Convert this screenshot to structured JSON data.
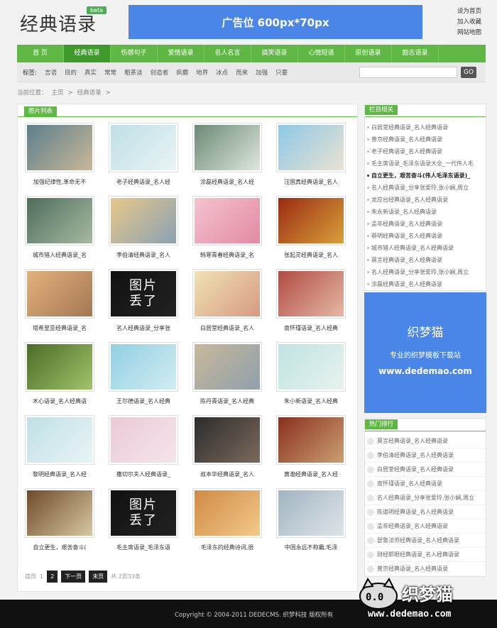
{
  "header": {
    "logo": "经典语录",
    "beta": "beta",
    "ad": "广告位 600px*70px",
    "links": [
      "设为首页",
      "加入收藏",
      "网站地图"
    ]
  },
  "nav": [
    "首 页",
    "经典语录",
    "伤感句子",
    "爱情语录",
    "名人名言",
    "搞笑语录",
    "心情短语",
    "原创语录",
    "励志语录"
  ],
  "tags": {
    "label": "标签:",
    "items": [
      "言语",
      "目的",
      "真实",
      "常常",
      "粗茶淡",
      "创造者",
      "疯癫",
      "地界",
      "冰点",
      "而来",
      "加强",
      "只要"
    ]
  },
  "search": {
    "button": "GO"
  },
  "breadcrumb": [
    "当前位置：",
    "主页",
    ">",
    "经典语录",
    ">"
  ],
  "main": {
    "tab": "图片列表",
    "cards": [
      {
        "caption": "加强纪律性,革命无不",
        "c1": "#5d7f8a",
        "c2": "#c9b79a"
      },
      {
        "caption": "老子经典语录_名人经",
        "c1": "#bfe0e6",
        "c2": "#e9f3f4"
      },
      {
        "caption": "涂磊经典语录_名人经",
        "c1": "#6b8a74",
        "c2": "#dfe6de"
      },
      {
        "caption": "汪国真经典语录_名人",
        "c1": "#8fc8e6",
        "c2": "#e9e2d3"
      },
      {
        "caption": "城市猎人经典语录_名",
        "c1": "#4e6e5d",
        "c2": "#a7b9a0"
      },
      {
        "caption": "李伯清经典语录_名人",
        "c1": "#e7c88b",
        "c2": "#8aa1b3"
      },
      {
        "caption": "韩寒青春经典语录_名",
        "c1": "#f3c3cf",
        "c2": "#e48aa3"
      },
      {
        "caption": "张起灵经典语录_名人",
        "c1": "#9b2a12",
        "c2": "#d8a13a"
      },
      {
        "caption": "塔希里亚经典语录_名",
        "c1": "#e2b27b",
        "c2": "#a57754"
      },
      {
        "caption": "名人经典语录_分享张",
        "c1": "#111111",
        "c2": "#222222"
      },
      {
        "caption": "白居堂经典语录_名人",
        "c1": "#efe2b3",
        "c2": "#d99a82"
      },
      {
        "caption": "南怀瑾语录_名人经典",
        "c1": "#b24b44",
        "c2": "#e5b8a4"
      },
      {
        "caption": "木心语录_名人经典语",
        "c1": "#4c6b27",
        "c2": "#a2c36a"
      },
      {
        "caption": "王尔德语录_名人经典",
        "c1": "#92d0e3",
        "c2": "#d1ecf1"
      },
      {
        "caption": "陈丹青语录_名人经典",
        "c1": "#c7b89a",
        "c2": "#8fa0ad"
      },
      {
        "caption": "朱小新语录_名人经典",
        "c1": "#bfe3e0",
        "c2": "#e7f2f0"
      },
      {
        "caption": "黎明经典语录_名人经",
        "c1": "#bfe0e6",
        "c2": "#e9f3f4"
      },
      {
        "caption": "撒切尔夫人经典语录_",
        "c1": "#e9c9d6",
        "c2": "#f6e5ec"
      },
      {
        "caption": "叔本华经典语录_名人",
        "c1": "#2c2c2c",
        "c2": "#7a6a5d"
      },
      {
        "caption": "黄渤经典语录_名人经",
        "c1": "#8a2f1f",
        "c2": "#caa070"
      },
      {
        "caption": "自立更生，艰苦奋斗(",
        "c1": "#6e4b2a",
        "c2": "#d8c6a2"
      },
      {
        "caption": "毛主席语录_毛泽东语",
        "c1": "#111111",
        "c2": "#222222"
      },
      {
        "caption": "毛泽东的经典诗词,很",
        "c1": "#d18a45",
        "c2": "#f2c98a"
      },
      {
        "caption": "中国永远不称霸,毛泽",
        "c1": "#9fb5c3",
        "c2": "#dfe4e6"
      }
    ],
    "lost_img_text": [
      "图片",
      "丢了"
    ]
  },
  "pager": {
    "items": [
      "首页",
      "1",
      "2",
      "下一页",
      "末页",
      "共 2页33条"
    ]
  },
  "side1": {
    "tab": "栏目相关",
    "items": [
      "白居堂经典语录_名人经典语录",
      "普京经典语录_名人经典语录",
      "老子经典语录_名人经典语录",
      "毛主席语录_毛泽东语录大全_一代伟人毛",
      "自立更生，艰苦奋斗(伟人毛泽东语录)_",
      "名人经典语录_分享张爱玲,张小娴,周立",
      "龙应台经典语录_名人经典语录",
      "朱永新语录_名人经典语录",
      "孟非经典语录_名人经典语录",
      "蔡明经典语录_名人经典语录",
      "城市猎人经典语录_名人经典语录",
      "莫言经典语录_名人经典语录",
      "名人经典语录_分享张爱玲,张小娴,周立",
      "涂磊经典语录_名人经典语录"
    ],
    "strong_index": 4
  },
  "ad_side": {
    "title": "织梦猫",
    "sub": "专业的织梦模板下载站",
    "url": "www.dedemao.com"
  },
  "side2": {
    "tab": "热门排行",
    "items": [
      "莫言经典语录_名人经典语录",
      "李伯清经典语录_名人经典语录",
      "白居堂经典语录_名人经典语录",
      "南怀瑾语录_名人经典语录",
      "名人经典语录_分享张爱玲,张小娴,周立",
      "陈道明经典语录_名人经典语录",
      "孟非经典语录_名人经典语录",
      "瑟鲁法师经典语录_名人经典语录",
      "财经郎眼经典语录_名人经典语录",
      "普京经典语录_名人经典语录"
    ]
  },
  "footer": {
    "copyright": "Copyright © 2004-2011 DEDECMS. 织梦科技 版权所有",
    "wm_zh": "织梦猫",
    "wm_url": "www.dedemao.com"
  },
  "colors": {
    "green": "#5fb843",
    "green_dark": "#3f9a2c",
    "blue": "#4a86e8"
  }
}
